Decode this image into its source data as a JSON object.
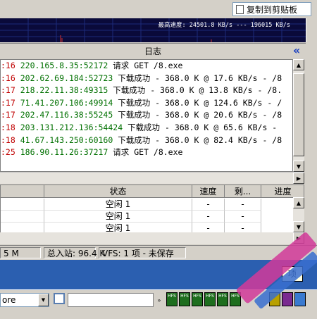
{
  "toolbar": {
    "copy_label": "复制到剪贴板"
  },
  "graph": {
    "speed_text": "最高速度: 24501.8 KB/s --- 196015 KB/s"
  },
  "log_panel": {
    "title": "日志",
    "collapse_icon": "double-chevron-left-icon",
    "lines": [
      {
        "time": ":16",
        "ip": "220.165.8.35:52172",
        "msg": "请求 GET /8.exe"
      },
      {
        "time": ":16",
        "ip": "202.62.69.184:52723",
        "msg": "下载成功 - 368.0 K @ 17.6 KB/s - /8"
      },
      {
        "time": ":17",
        "ip": "218.22.11.38:49315",
        "msg": "下载成功 - 368.0 K @ 13.8 KB/s - /8."
      },
      {
        "time": ":17",
        "ip": "71.41.207.106:49914",
        "msg": "下载成功 - 368.0 K @ 124.6 KB/s - /"
      },
      {
        "time": ":17",
        "ip": "202.47.116.38:55245",
        "msg": "下载成功 - 368.0 K @ 20.6 KB/s - /8"
      },
      {
        "time": ":18",
        "ip": "203.131.212.136:54424",
        "msg": "下载成功 - 368.0 K @ 65.6 KB/s -"
      },
      {
        "time": ":18",
        "ip": "41.67.143.250:60160",
        "msg": "下载成功 - 368.0 K @ 82.4 KB/s - /8"
      },
      {
        "time": ":25",
        "ip": "186.90.11.26:37217",
        "msg": "请求 GET /8.exe"
      }
    ]
  },
  "table": {
    "columns": [
      "状态",
      "速度",
      "剩...",
      "进度"
    ],
    "rows": [
      {
        "status": "空闲 1",
        "speed": "-",
        "remaining": "-"
      },
      {
        "status": "空闲 1",
        "speed": "-",
        "remaining": "-"
      },
      {
        "status": "空闲 1",
        "speed": "-",
        "remaining": "-"
      }
    ]
  },
  "statusbar": {
    "seg1": "5 M",
    "seg2": "总入站: 96.4 K",
    "seg3": "VFS: 1 项 - 未保存"
  },
  "desktop": {
    "tooltip": "项"
  },
  "taskbar": {
    "combo_value": "ore",
    "tray_labels": [
      "HFS",
      "HFS",
      "HFS",
      "HFS",
      "HFS",
      "HFS"
    ]
  },
  "colors": {
    "graph_bg": "#0a0a3a",
    "time_color": "#c00000",
    "ip_color": "#007000",
    "desktop_blue": "#2b5fb0"
  }
}
